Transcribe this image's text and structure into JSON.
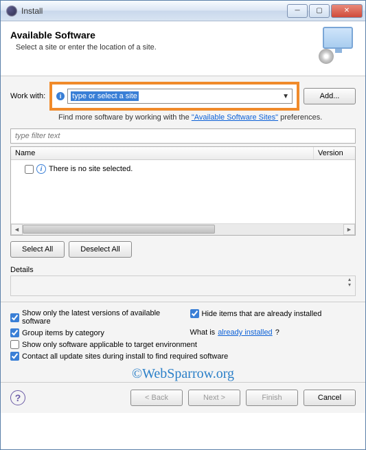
{
  "titlebar": {
    "title": "Install"
  },
  "header": {
    "heading": "Available Software",
    "subheading": "Select a site or enter the location of a site."
  },
  "workwith": {
    "label": "Work with:",
    "combo_text": "type or select a site",
    "add_button": "Add...",
    "hint_prefix": "Find more software by working with the ",
    "hint_link": "\"Available Software Sites\"",
    "hint_suffix": " preferences."
  },
  "filter": {
    "placeholder": "type filter text"
  },
  "tree": {
    "col_name": "Name",
    "col_version": "Version",
    "empty_text": "There is no site selected."
  },
  "buttons": {
    "select_all": "Select All",
    "deselect_all": "Deselect All"
  },
  "details": {
    "label": "Details"
  },
  "options": {
    "show_latest": "Show only the latest versions of available software",
    "hide_installed": "Hide items that are already installed",
    "group_by_category": "Group items by category",
    "what_is_prefix": "What is ",
    "what_is_link": "already installed",
    "what_is_suffix": "?",
    "show_applicable": "Show only software applicable to target environment",
    "contact_sites": "Contact all update sites during install to find required software"
  },
  "watermark": "©WebSparrow.org",
  "footer": {
    "back": "< Back",
    "next": "Next >",
    "finish": "Finish",
    "cancel": "Cancel"
  }
}
